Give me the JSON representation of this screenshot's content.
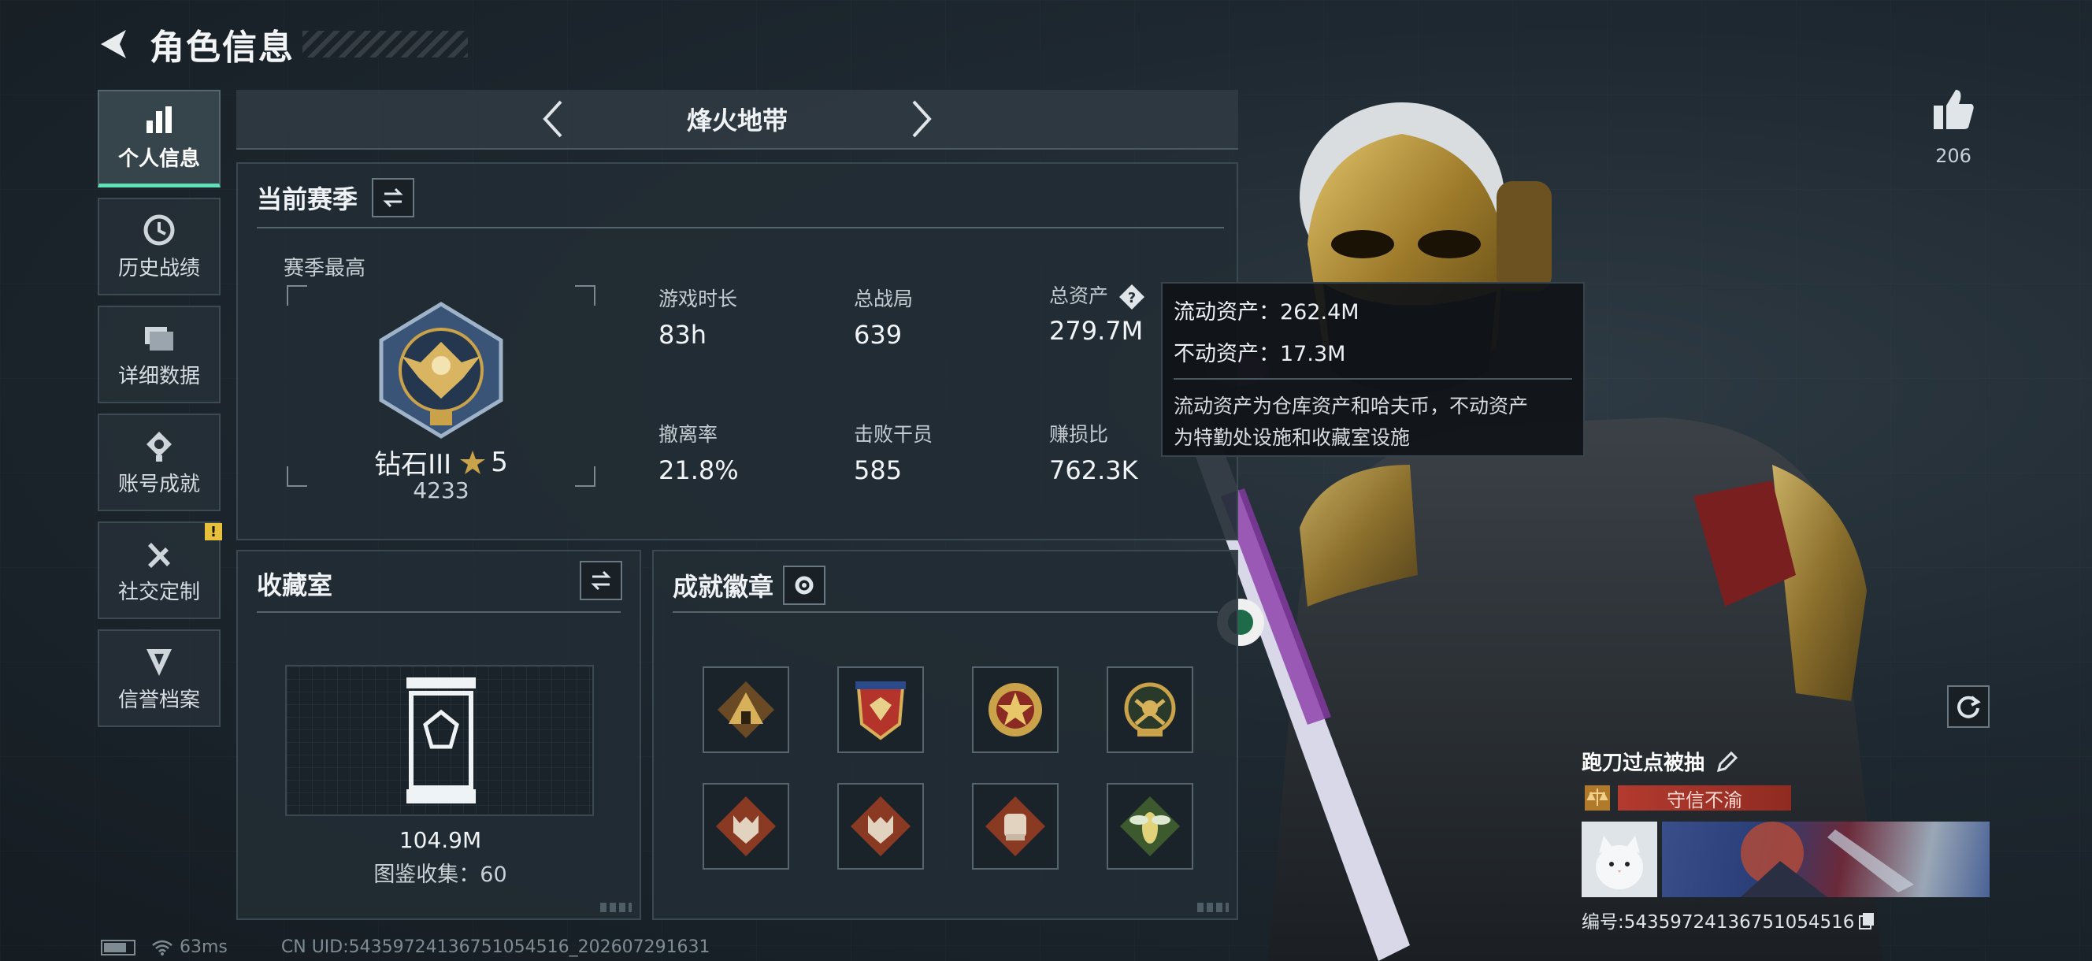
{
  "header": {
    "title": "角色信息"
  },
  "sidebar": {
    "items": [
      {
        "label": "个人信息",
        "icon": "bar-chart-icon",
        "active": true
      },
      {
        "label": "历史战绩",
        "icon": "history-icon"
      },
      {
        "label": "详细数据",
        "icon": "folder-icon"
      },
      {
        "label": "账号成就",
        "icon": "medal-icon"
      },
      {
        "label": "社交定制",
        "icon": "tools-icon",
        "badge": "!"
      },
      {
        "label": "信誉档案",
        "icon": "shield-icon"
      }
    ]
  },
  "mode": {
    "name": "烽火地带"
  },
  "season": {
    "title": "当前赛季",
    "best_label": "赛季最高",
    "rank_name": "钻石III",
    "rank_stars": "5",
    "rank_points": "4233",
    "stats": [
      {
        "label": "游戏时长",
        "value": "83h"
      },
      {
        "label": "总战局",
        "value": "639"
      },
      {
        "label": "总资产",
        "value": "279.7M"
      },
      {
        "label": "撤离率",
        "value": "21.8%"
      },
      {
        "label": "击败干员",
        "value": "585"
      },
      {
        "label": "赚损比",
        "value": "762.3K"
      }
    ]
  },
  "tooltip": {
    "liquid": "流动资产：262.4M",
    "fixed": "不动资产：17.3M",
    "desc_line1": "流动资产为仓库资产和哈夫币，不动资产",
    "desc_line2": "为特勤处设施和收藏室设施"
  },
  "collection": {
    "title": "收藏室",
    "value": "104.9M",
    "count": "图鉴收集：60"
  },
  "badges": {
    "title": "成就徽章",
    "items": [
      "pyramid-badge-icon",
      "eagle-shield-badge-icon",
      "star-cross-badge-icon",
      "wreath-skull-badge-icon",
      "wolf-badge-icon",
      "wolf-badge-2-icon",
      "fist-badge-icon",
      "wasp-badge-icon"
    ]
  },
  "player": {
    "like_count": "206",
    "name": "跑刀过点被抽",
    "trust": "守信不渝",
    "uid": "编号:5435972413675105451​6"
  },
  "status": {
    "ping": "63ms",
    "uid": "CN UID:5435972413675105451​6_202607291631"
  },
  "colors": {
    "accent": "#5ee0b8",
    "trust": "#b33a2e",
    "badge_warn": "#e8c13b"
  }
}
